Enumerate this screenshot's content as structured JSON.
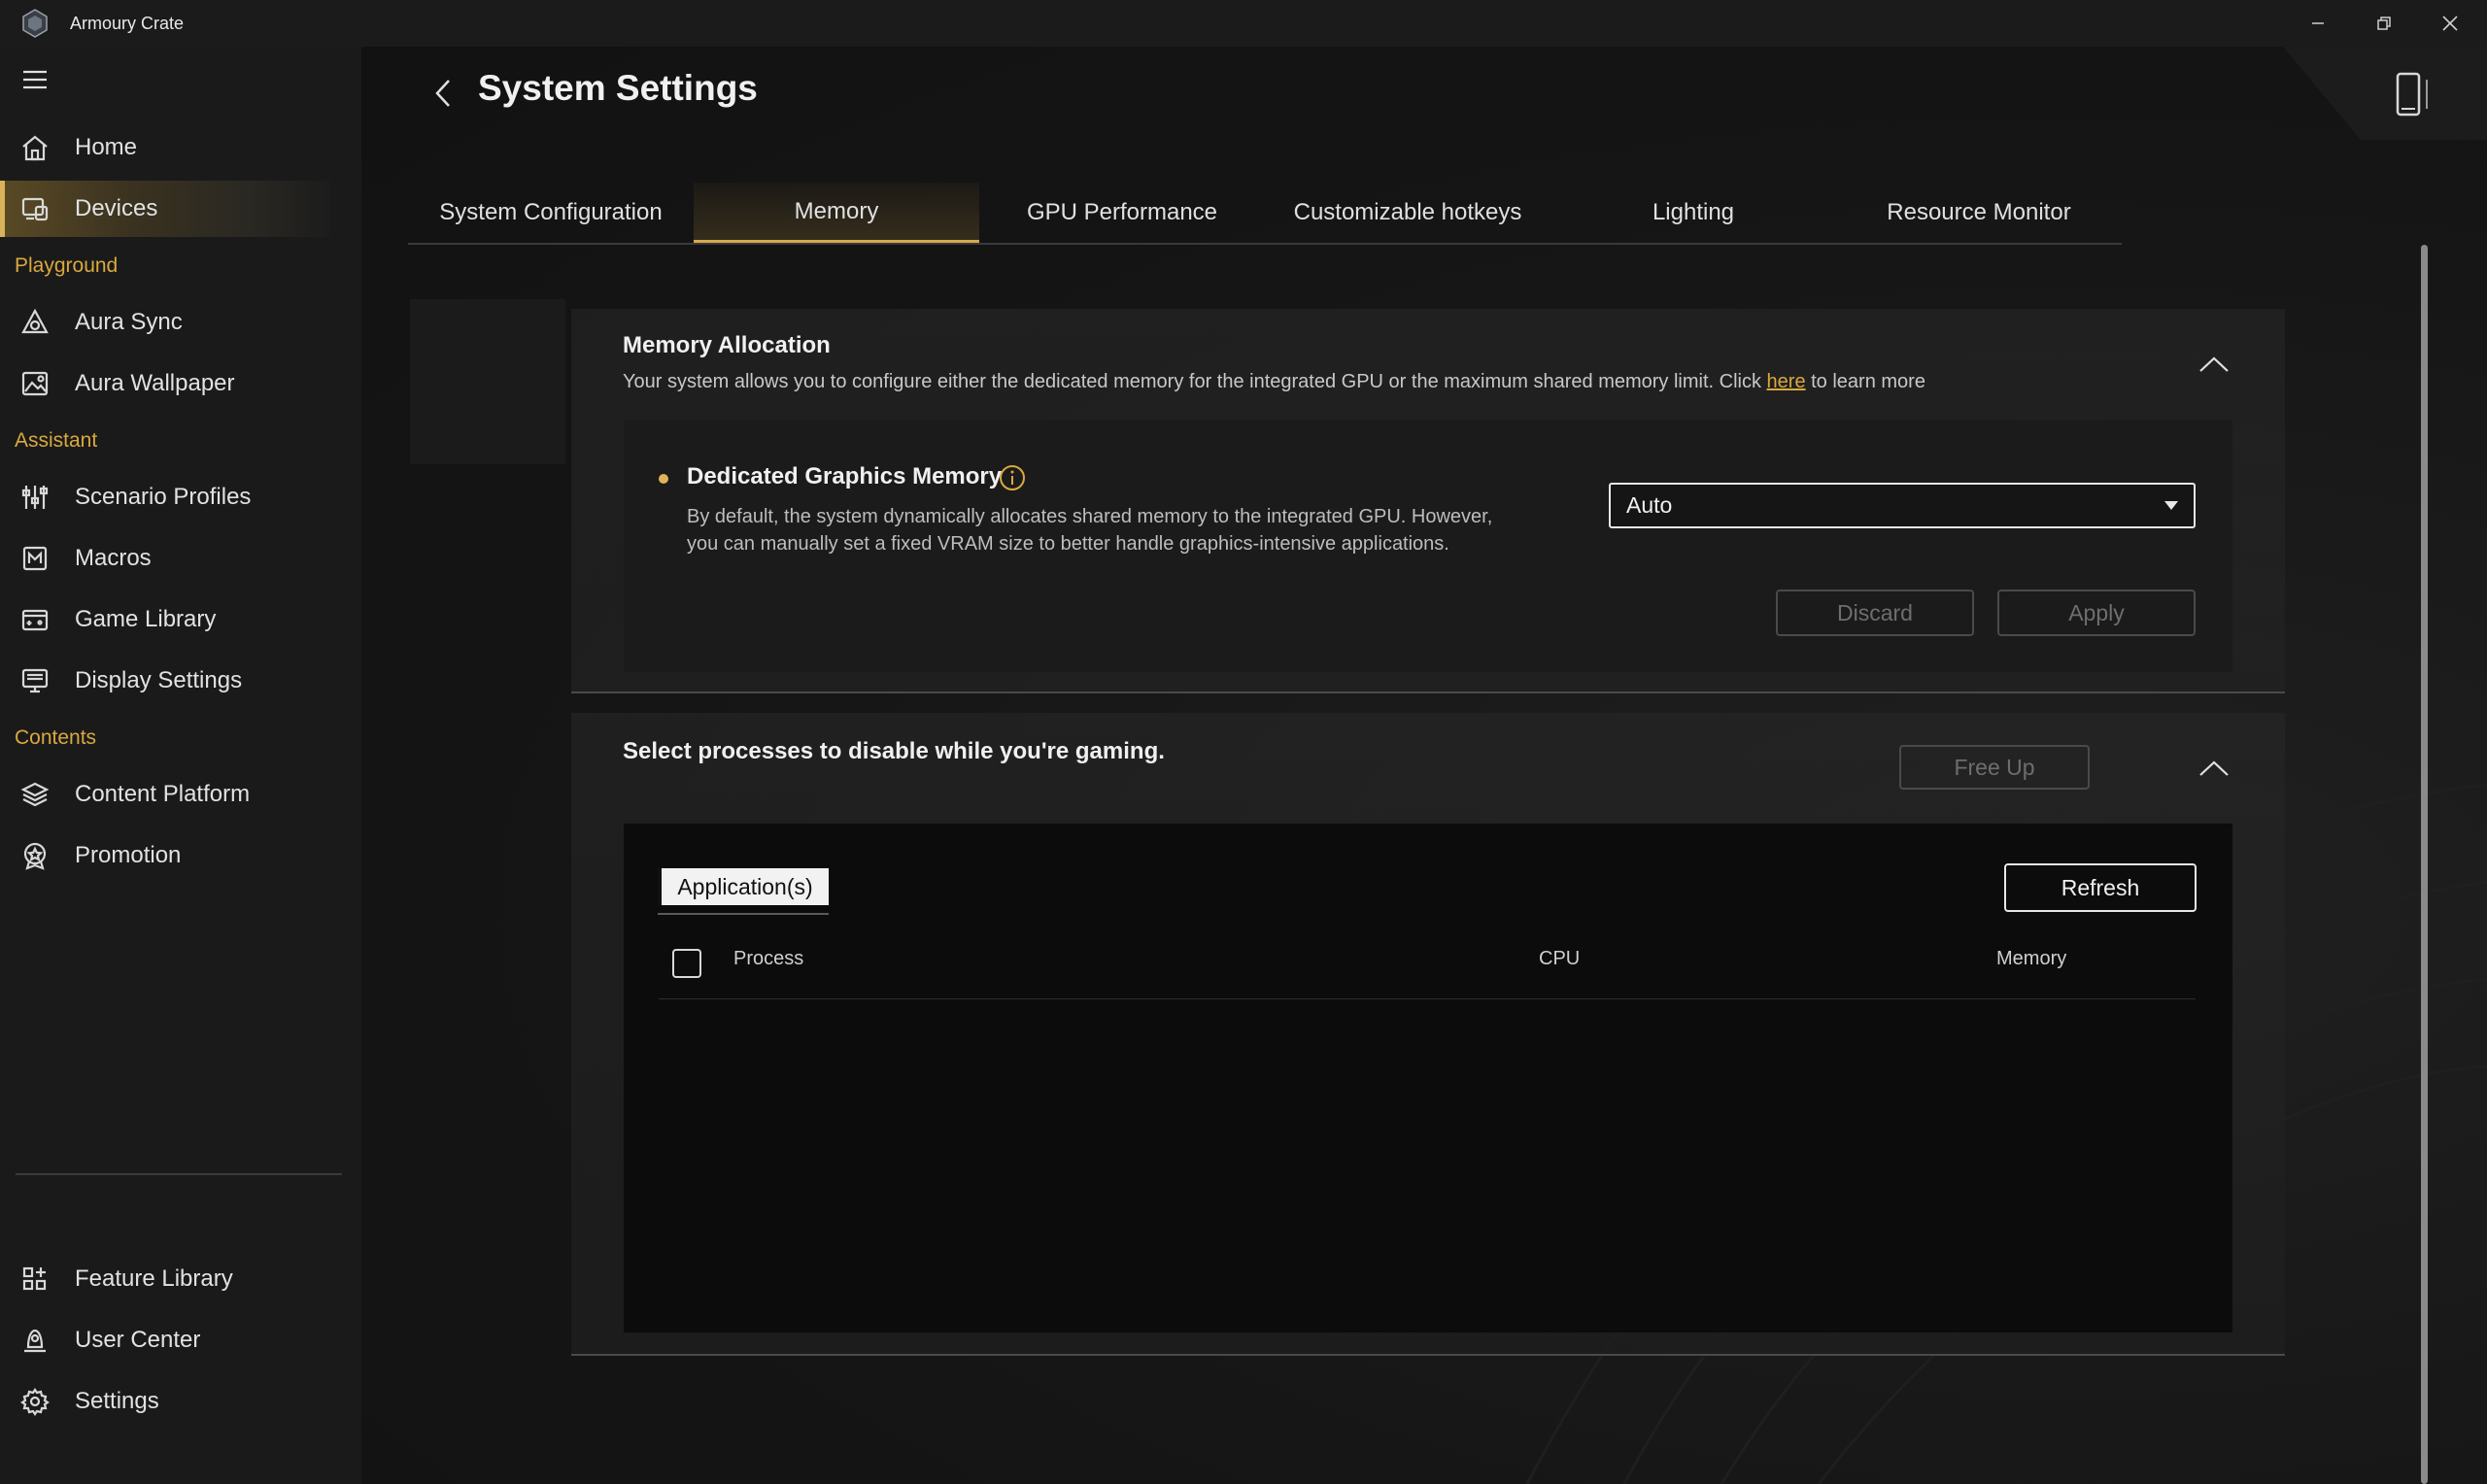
{
  "window": {
    "title": "Armoury Crate"
  },
  "sidebar": {
    "items": [
      {
        "label": "Home",
        "icon": "home-icon"
      },
      {
        "label": "Devices",
        "icon": "devices-icon"
      },
      {
        "label": "Aura Sync",
        "icon": "aura-sync-icon"
      },
      {
        "label": "Aura Wallpaper",
        "icon": "wallpaper-icon"
      },
      {
        "label": "Scenario Profiles",
        "icon": "sliders-icon"
      },
      {
        "label": "Macros",
        "icon": "macros-icon"
      },
      {
        "label": "Game Library",
        "icon": "game-library-icon"
      },
      {
        "label": "Display Settings",
        "icon": "display-icon"
      },
      {
        "label": "Content Platform",
        "icon": "layers-icon"
      },
      {
        "label": "Promotion",
        "icon": "promotion-icon"
      },
      {
        "label": "Feature Library",
        "icon": "feature-library-icon"
      },
      {
        "label": "User Center",
        "icon": "user-icon"
      },
      {
        "label": "Settings",
        "icon": "gear-icon"
      }
    ],
    "active_index": 1,
    "sections": {
      "playground": "Playground",
      "assistant": "Assistant",
      "contents": "Contents"
    }
  },
  "page": {
    "title": "System Settings"
  },
  "tabs": [
    {
      "label": "System Configuration"
    },
    {
      "label": "Memory"
    },
    {
      "label": "GPU Performance"
    },
    {
      "label": "Customizable hotkeys"
    },
    {
      "label": "Lighting"
    },
    {
      "label": "Resource Monitor"
    }
  ],
  "active_tab": 1,
  "memory_allocation": {
    "title": "Memory Allocation",
    "desc_before": "Your system allows you to configure either the dedicated memory for the integrated GPU or the maximum shared memory limit. Click ",
    "desc_link": "here",
    "desc_after": " to learn more",
    "option": {
      "title": "Dedicated Graphics Memory",
      "desc_line1": "By default, the system dynamically allocates shared memory to the integrated GPU. However,",
      "desc_line2": "you can manually set a fixed VRAM size to better handle graphics-intensive applications.",
      "selected_value": "Auto"
    },
    "discard_label": "Discard",
    "apply_label": "Apply"
  },
  "processes": {
    "title": "Select processes to disable while you're gaming.",
    "free_up_label": "Free Up",
    "app_tab_label": "Application(s)",
    "refresh_label": "Refresh",
    "columns": [
      "Process",
      "CPU",
      "Memory"
    ],
    "rows": []
  },
  "colors": {
    "accent": "#d9a93f",
    "background": "#141414",
    "sidebar": "#1a1a1a"
  }
}
